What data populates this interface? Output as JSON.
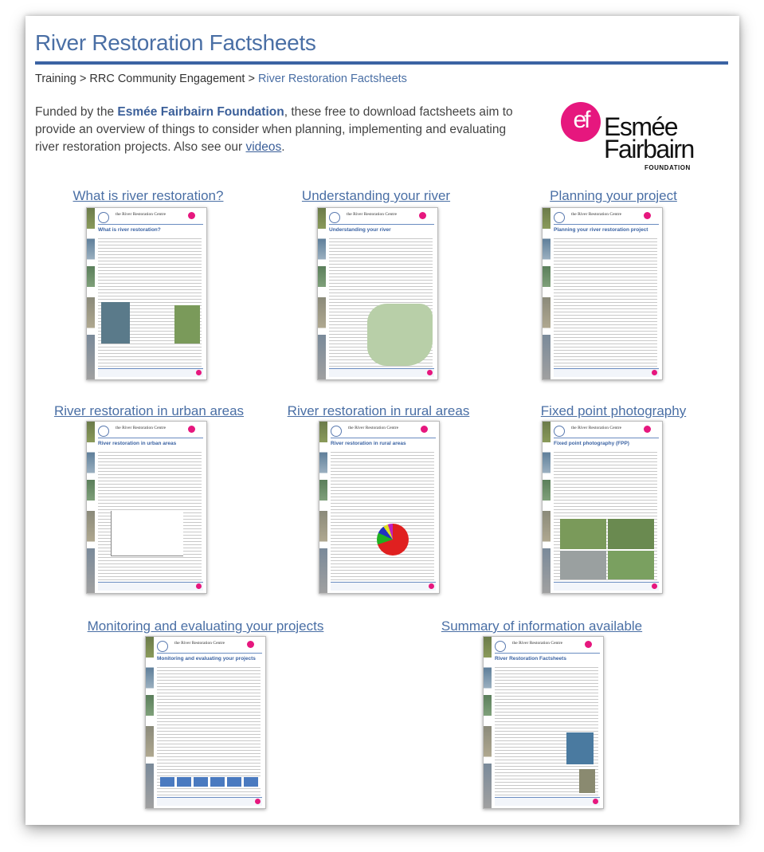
{
  "page": {
    "title": "River Restoration Factsheets",
    "breadcrumb": {
      "items": [
        "Training",
        "RRC Community Engagement"
      ],
      "separator": ">",
      "current": "River Restoration Factsheets"
    },
    "intro": {
      "prefix": "Funded by the ",
      "foundation": "Esmée Fairbairn Foundation",
      "middle": ", these free to download factsheets aim to provide an overview of things to consider when planning, implementing and evaluating river restoration projects. Also see our ",
      "link": "videos",
      "suffix": "."
    },
    "logo": {
      "mark": "ef",
      "line1": "Esmée",
      "line2": "Fairbairn",
      "line3": "FOUNDATION",
      "color": "#e6177e"
    }
  },
  "thumb_header": "the River Restoration Centre",
  "factsheets": [
    {
      "label": "What is river restoration?",
      "doc_title": "What is river restoration?"
    },
    {
      "label": "Understanding your river",
      "doc_title": "Understanding your river"
    },
    {
      "label": "Planning your project",
      "doc_title": "Planning your river restoration project"
    },
    {
      "label": "River restoration in urban areas",
      "doc_title": "River restoration in urban areas"
    },
    {
      "label": "River restoration in rural areas",
      "doc_title": "River restoration in rural areas"
    },
    {
      "label": "Fixed point photography",
      "doc_title": "Fixed point photography (FPP)"
    },
    {
      "label": "Monitoring and evaluating your projects",
      "doc_title": "Monitoring and evaluating your projects"
    },
    {
      "label": "Summary of information available",
      "doc_title": "River Restoration Factsheets"
    }
  ],
  "colors": {
    "accent": "#3b63a3",
    "link": "#4a6fa5",
    "brand_pink": "#e6177e"
  }
}
